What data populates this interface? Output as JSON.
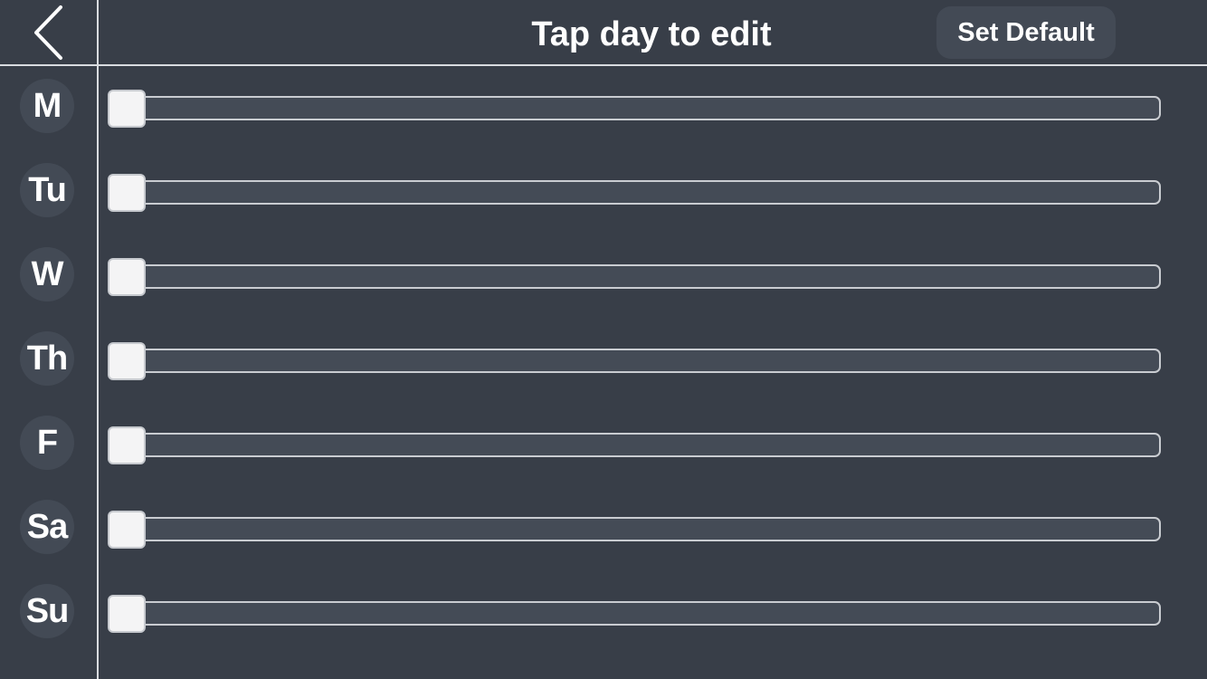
{
  "header": {
    "title": "Tap day to edit",
    "set_default_label": "Set Default",
    "back_icon": "chevron-left-icon"
  },
  "days": [
    {
      "label": "M",
      "progress": 0
    },
    {
      "label": "Tu",
      "progress": 0
    },
    {
      "label": "W",
      "progress": 0
    },
    {
      "label": "Th",
      "progress": 0
    },
    {
      "label": "F",
      "progress": 0
    },
    {
      "label": "Sa",
      "progress": 0
    },
    {
      "label": "Su",
      "progress": 0
    }
  ],
  "colors": {
    "background": "#383e48",
    "divider": "#d9dce0",
    "badge": "#434a55",
    "track": "#444b56",
    "handle": "#f4f4f5",
    "text": "#ffffff"
  }
}
